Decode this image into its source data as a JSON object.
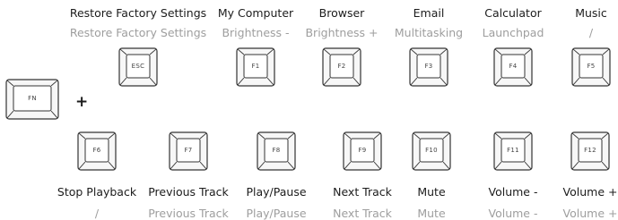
{
  "modifier": {
    "key": "FN",
    "plus": "+"
  },
  "top_row": [
    {
      "key": "ESC",
      "windows": "Restore Factory Settings",
      "mac": "Restore Factory Settings"
    },
    {
      "key": "F1",
      "windows": "My Computer",
      "mac": "Brightness -"
    },
    {
      "key": "F2",
      "windows": "Browser",
      "mac": "Brightness +"
    },
    {
      "key": "F3",
      "windows": "Email",
      "mac": "Multitasking"
    },
    {
      "key": "F4",
      "windows": "Calculator",
      "mac": "Launchpad"
    },
    {
      "key": "F5",
      "windows": "Music",
      "mac": "/"
    }
  ],
  "bottom_row": [
    {
      "key": "F6",
      "windows": "Stop Playback",
      "mac": "/"
    },
    {
      "key": "F7",
      "windows": "Previous Track",
      "mac": "Previous Track"
    },
    {
      "key": "F8",
      "windows": "Play/Pause",
      "mac": "Play/Pause"
    },
    {
      "key": "F9",
      "windows": "Next Track",
      "mac": "Next Track"
    },
    {
      "key": "F10",
      "windows": "Mute",
      "mac": "Mute"
    },
    {
      "key": "F11",
      "windows": "Volume -",
      "mac": "Volume -"
    },
    {
      "key": "F12",
      "windows": "Volume +",
      "mac": "Volume +"
    }
  ],
  "colors": {
    "windows_text": "#1c1c1c",
    "mac_text": "#9e9e9e",
    "key_outline": "#333333",
    "key_fill": "#f7f7f7"
  }
}
